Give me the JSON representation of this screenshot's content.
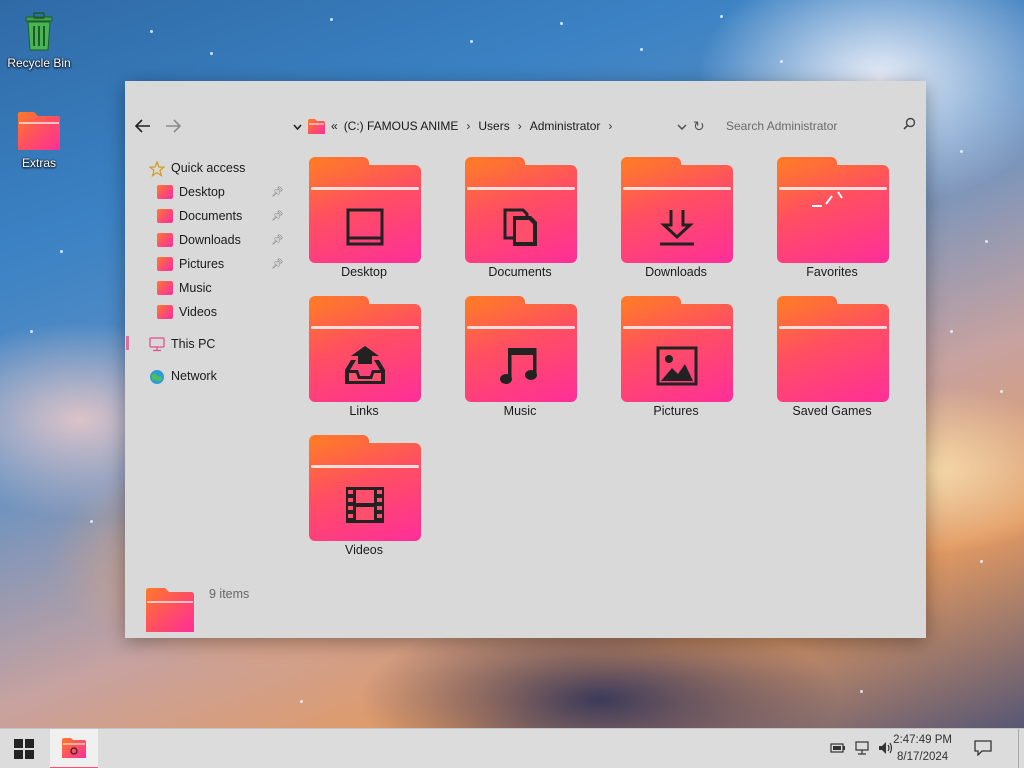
{
  "desktop": {
    "icons": [
      {
        "label": "Recycle Bin",
        "icon": "recycle-bin-icon"
      },
      {
        "label": "Extras",
        "icon": "folder-icon"
      }
    ]
  },
  "explorer": {
    "nav": {
      "back": "←",
      "forward": "→"
    },
    "breadcrumb": {
      "overflow": "«",
      "items": [
        "(C:) FAMOUS ANIME",
        "Users",
        "Administrator"
      ]
    },
    "refresh_glyph": "↻",
    "search_placeholder": "Search Administrator",
    "sidebar": {
      "quick_access": "Quick access",
      "items": [
        {
          "label": "Desktop",
          "pinned": true
        },
        {
          "label": "Documents",
          "pinned": true
        },
        {
          "label": "Downloads",
          "pinned": true
        },
        {
          "label": "Pictures",
          "pinned": true
        },
        {
          "label": "Music",
          "pinned": false
        },
        {
          "label": "Videos",
          "pinned": false
        }
      ],
      "this_pc": "This PC",
      "network": "Network"
    },
    "folders": [
      {
        "label": "Desktop",
        "icon": "desktop-glyph-icon"
      },
      {
        "label": "Documents",
        "icon": "documents-glyph-icon"
      },
      {
        "label": "Downloads",
        "icon": "download-glyph-icon"
      },
      {
        "label": "Favorites",
        "icon": "star-glyph-icon"
      },
      {
        "label": "Links",
        "icon": "upload-tray-icon"
      },
      {
        "label": "Music",
        "icon": "music-note-icon"
      },
      {
        "label": "Pictures",
        "icon": "picture-icon"
      },
      {
        "label": "Saved Games",
        "icon": "none"
      },
      {
        "label": "Videos",
        "icon": "film-icon"
      }
    ],
    "status": "9 items"
  },
  "taskbar": {
    "time": "2:47:49 PM",
    "date": "8/17/2024"
  },
  "colors": {
    "folder_gradient_start": "#ff7a28",
    "folder_gradient_end": "#ff2e9a",
    "window_bg": "#d9d9d9",
    "taskbar_bg": "#dcdcdc"
  }
}
